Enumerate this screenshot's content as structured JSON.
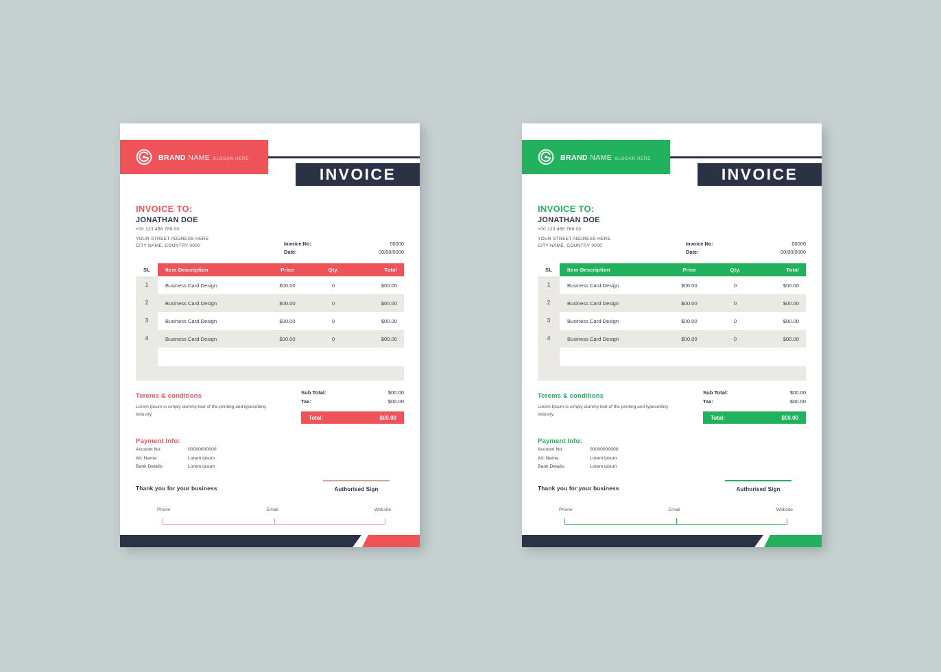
{
  "canvas": {
    "background": "#c7d0d0"
  },
  "theme": {
    "navy": "#2b3245",
    "beige": "#ebe9e4",
    "red": "#ee5359",
    "green": "#22b15c"
  },
  "invoices": [
    {
      "variant": "red",
      "accent": "#ee5359",
      "brand": {
        "logo_icon": "circular-spiral-logo-icon",
        "name_bold": "BRAND",
        "name_light": "NAME",
        "slogan": "SLOGAN HERE"
      },
      "banner_title": "INVOICE",
      "bill": {
        "label": "INVOICE TO:",
        "name": "JONATHAN DOE",
        "phone": "+00 123 456 789 00",
        "address_line1": "YOUR STREET ADDRESS HERE",
        "address_line2": "CITY NAME, COUNTRY 0000"
      },
      "meta": [
        {
          "key": "Invoice No:",
          "value": "00000"
        },
        {
          "key": "Date:",
          "value": "00/00/0000"
        }
      ],
      "table": {
        "headers": {
          "sl": "SL",
          "description": "Item Description",
          "price": "Price",
          "qty": "Qty.",
          "total": "Total"
        },
        "rows": [
          {
            "sl": "1",
            "description": "Business Card Design",
            "price": "$00.00",
            "qty": "0",
            "total": "$00.00"
          },
          {
            "sl": "2",
            "description": "Business Card Design",
            "price": "$00.00",
            "qty": "0",
            "total": "$00.00"
          },
          {
            "sl": "3",
            "description": "Business Card Design",
            "price": "$00.00",
            "qty": "0",
            "total": "$00.00"
          },
          {
            "sl": "4",
            "description": "Business Card Design",
            "price": "$00.00",
            "qty": "0",
            "total": "$00.00"
          }
        ]
      },
      "terms": {
        "title": "Terems & conditions",
        "body": "Lorem Ipsum is simply dummy text of the printing and typesetting industry."
      },
      "totals": {
        "subtotal_label": "Sub Total:",
        "subtotal_value": "$00.00",
        "tax_label": "Tax:",
        "tax_value": "$00.00",
        "grand_label": "Total:",
        "grand_value": "$00.00"
      },
      "payment": {
        "title": "Payment Info:",
        "rows": [
          {
            "key": "Account No:",
            "value": "00000000000"
          },
          {
            "key": "A/c Name:",
            "value": "Lorem ipsum"
          },
          {
            "key": "Bank Details:",
            "value": "Lorem ipsum"
          }
        ]
      },
      "thanks": "Thank you for your business",
      "sign_label": "Authorised Sign",
      "contact": {
        "phone": "Phone",
        "email": "Email",
        "website": "Website"
      }
    },
    {
      "variant": "green",
      "accent": "#22b15c",
      "brand": {
        "logo_icon": "circular-spiral-logo-icon",
        "name_bold": "BRAND",
        "name_light": "NAME",
        "slogan": "SLOGAN HERE"
      },
      "banner_title": "INVOICE",
      "bill": {
        "label": "INVOICE TO:",
        "name": "JONATHAN DOE",
        "phone": "+00 123 456 789 00",
        "address_line1": "YOUR STREET ADDRESS HERE",
        "address_line2": "CITY NAME, COUNTRY 0000"
      },
      "meta": [
        {
          "key": "Invoice No:",
          "value": "00000"
        },
        {
          "key": "Date:",
          "value": "00/00/0000"
        }
      ],
      "table": {
        "headers": {
          "sl": "SL",
          "description": "Item Description",
          "price": "Price",
          "qty": "Qty.",
          "total": "Total"
        },
        "rows": [
          {
            "sl": "1",
            "description": "Business Card Design",
            "price": "$00.00",
            "qty": "0",
            "total": "$00.00"
          },
          {
            "sl": "2",
            "description": "Business Card Design",
            "price": "$00.00",
            "qty": "0",
            "total": "$00.00"
          },
          {
            "sl": "3",
            "description": "Business Card Design",
            "price": "$00.00",
            "qty": "0",
            "total": "$00.00"
          },
          {
            "sl": "4",
            "description": "Business Card Design",
            "price": "$00.00",
            "qty": "0",
            "total": "$00.00"
          }
        ]
      },
      "terms": {
        "title": "Terems & conditions",
        "body": "Lorem Ipsum is simply dummy text of the printing and typesetting industry."
      },
      "totals": {
        "subtotal_label": "Sub Total:",
        "subtotal_value": "$00.00",
        "tax_label": "Tax:",
        "tax_value": "$00.00",
        "grand_label": "Total:",
        "grand_value": "$00.00"
      },
      "payment": {
        "title": "Payment Info:",
        "rows": [
          {
            "key": "Account No:",
            "value": "00000000000"
          },
          {
            "key": "A/c Name:",
            "value": "Lorem ipsum"
          },
          {
            "key": "Bank Details:",
            "value": "Lorem ipsum"
          }
        ]
      },
      "thanks": "Thank you for your business",
      "sign_label": "Authorised Sign",
      "contact": {
        "phone": "Phone",
        "email": "Email",
        "website": "Website"
      }
    }
  ]
}
